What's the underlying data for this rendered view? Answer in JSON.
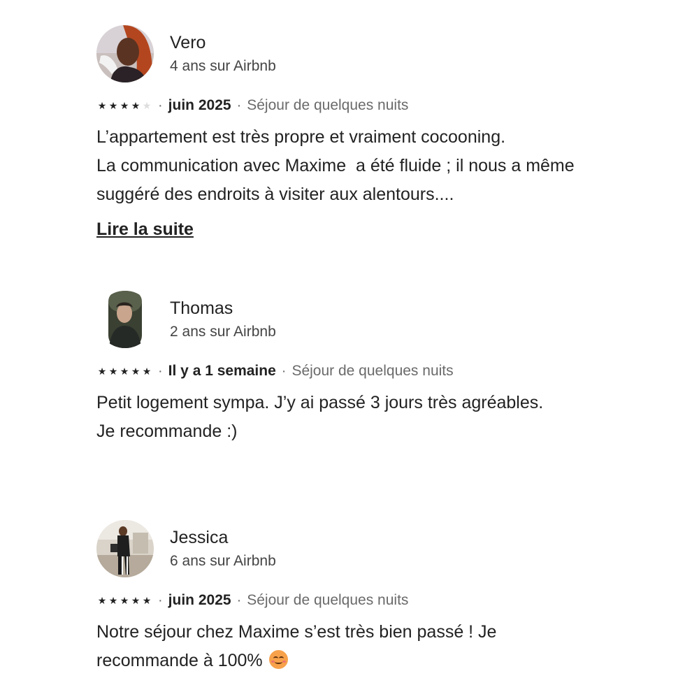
{
  "reviews": [
    {
      "name": "Vero",
      "tenure": "4 ans sur Airbnb",
      "rating": 4,
      "avatar_icon": "user-photo-avatar",
      "date": "juin 2025",
      "stay": "Séjour de quelques nuits",
      "lines": [
        "L’appartement est très propre et vraiment cocooning.",
        "La communication avec Maxime  a été fluide ; il nous a même",
        "suggéré des endroits à visiter aux alentours...."
      ],
      "read_more": "Lire la suite"
    },
    {
      "name": "Thomas",
      "tenure": "2 ans sur Airbnb",
      "rating": 5,
      "avatar_icon": "user-photo-avatar",
      "date": "Il y a 1 semaine",
      "stay": "Séjour de quelques nuits",
      "lines": [
        "Petit logement sympa. J’y ai passé 3 jours très agréables.",
        "Je recommande :)"
      ]
    },
    {
      "name": "Jessica",
      "tenure": "6 ans sur Airbnb",
      "rating": 5,
      "avatar_icon": "user-photo-avatar",
      "date": "juin 2025",
      "stay": "Séjour de quelques nuits",
      "lines": [
        "Notre séjour chez Maxime s’est très bien passé ! Je",
        "recommande à 100%"
      ],
      "emoji_icon": "smiling-face-emoji-icon"
    }
  ],
  "separator": "·",
  "star_glyph": "★",
  "colors": {
    "text": "#222222",
    "muted": "#6a6a6a",
    "star_empty": "#dddddd"
  }
}
